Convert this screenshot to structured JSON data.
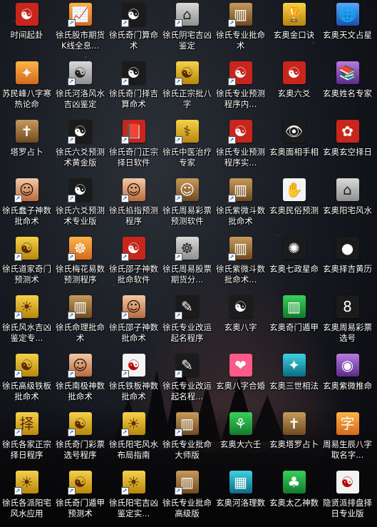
{
  "desktop": {
    "icons": [
      {
        "label": "时间起卦",
        "glyph": "☯",
        "style": "v-red",
        "shortcut": false
      },
      {
        "label": "徐氏股市期货K线全息...",
        "glyph": "📈",
        "style": "v-orange",
        "shortcut": true
      },
      {
        "label": "徐氏奇门算命术",
        "glyph": "☯",
        "style": "v-dark",
        "shortcut": true
      },
      {
        "label": "徐氏阴宅吉凶鉴定",
        "glyph": "⌂",
        "style": "v-gray",
        "shortcut": true
      },
      {
        "label": "徐氏专业批命术",
        "glyph": "▥",
        "style": "v-brown",
        "shortcut": true
      },
      {
        "label": "玄奥金口诀",
        "glyph": "🏆",
        "style": "v-gold",
        "shortcut": false
      },
      {
        "label": "玄奥天文占星",
        "glyph": "🌐",
        "style": "v-blue",
        "shortcut": false
      },
      {
        "label": "苏民峰八字寒热论命",
        "glyph": "✦",
        "style": "v-orange",
        "shortcut": false
      },
      {
        "label": "徐氏河洛风水吉凶鉴定",
        "glyph": "☯",
        "style": "v-gray",
        "shortcut": true
      },
      {
        "label": "徐氏奇门择吉算命术",
        "glyph": "☯",
        "style": "v-dark",
        "shortcut": true
      },
      {
        "label": "徐氏正宗批八字",
        "glyph": "☯",
        "style": "v-gold",
        "shortcut": true
      },
      {
        "label": "徐氏专业预测程序内...",
        "glyph": "☯",
        "style": "v-red",
        "shortcut": true
      },
      {
        "label": "玄奥六爻",
        "glyph": "☯",
        "style": "v-red",
        "shortcut": false
      },
      {
        "label": "玄奥姓名专家",
        "glyph": "📚",
        "style": "v-purple",
        "shortcut": false
      },
      {
        "label": "塔罗占卜",
        "glyph": "✝",
        "style": "v-brown",
        "shortcut": false
      },
      {
        "label": "徐氏六爻预测术黄金版",
        "glyph": "☯",
        "style": "v-dark",
        "shortcut": true
      },
      {
        "label": "徐氏奇门正宗择日软件",
        "glyph": "📕",
        "style": "v-red",
        "shortcut": true
      },
      {
        "label": "徐氏中医治疗专家",
        "glyph": "⚕",
        "style": "v-gold",
        "shortcut": true
      },
      {
        "label": "徐氏专业预测程序实...",
        "glyph": "☯",
        "style": "v-red",
        "shortcut": true
      },
      {
        "label": "玄奥面相手相",
        "glyph": "👁",
        "style": "v-dark",
        "shortcut": false
      },
      {
        "label": "玄奥玄空择日",
        "glyph": "✿",
        "style": "v-red",
        "shortcut": false
      },
      {
        "label": "徐氏蠢子神数批命术",
        "glyph": "☺",
        "style": "v-photo",
        "shortcut": true
      },
      {
        "label": "徐氏六爻预测术专业版",
        "glyph": "☯",
        "style": "v-dark",
        "shortcut": true
      },
      {
        "label": "徐氏掐指预测程序",
        "glyph": "☺",
        "style": "v-photo",
        "shortcut": true
      },
      {
        "label": "徐氏周易彩票预测软件",
        "glyph": "☺",
        "style": "v-brown",
        "shortcut": true
      },
      {
        "label": "徐氏紫微斗数批命术",
        "glyph": "▥",
        "style": "v-brown",
        "shortcut": true
      },
      {
        "label": "玄奥民俗预测",
        "glyph": "✋",
        "style": "v-white",
        "shortcut": false
      },
      {
        "label": "玄奥阳宅风水",
        "glyph": "⌂",
        "style": "v-gray",
        "shortcut": false
      },
      {
        "label": "徐氏道家奇门预测术",
        "glyph": "☯",
        "style": "v-gold",
        "shortcut": true
      },
      {
        "label": "徐氏梅花易数预测程序",
        "glyph": "☸",
        "style": "v-orange",
        "shortcut": true
      },
      {
        "label": "徐氏邵子神数批命软件",
        "glyph": "☯",
        "style": "v-red",
        "shortcut": true
      },
      {
        "label": "徐氏周易股票期货分...",
        "glyph": "☸",
        "style": "v-gray",
        "shortcut": true
      },
      {
        "label": "徐氏紫微斗数批命术...",
        "glyph": "▥",
        "style": "v-brown",
        "shortcut": true
      },
      {
        "label": "玄奥七政星命",
        "glyph": "✺",
        "style": "v-dark",
        "shortcut": false
      },
      {
        "label": "玄奥择吉黄历",
        "glyph": "●",
        "style": "v-dark",
        "shortcut": false
      },
      {
        "label": "徐氏风水吉凶鉴定专...",
        "glyph": "☀",
        "style": "v-gold",
        "shortcut": true
      },
      {
        "label": "徐氏命理批命术",
        "glyph": "▥",
        "style": "v-brown",
        "shortcut": true
      },
      {
        "label": "徐氏邵子神数批命术",
        "glyph": "☺",
        "style": "v-photo",
        "shortcut": true
      },
      {
        "label": "徐氏专业改运起名程序",
        "glyph": "✎",
        "style": "v-dark",
        "shortcut": true
      },
      {
        "label": "玄奥八字",
        "glyph": "☯",
        "style": "v-dark",
        "shortcut": false
      },
      {
        "label": "玄奥奇门遁甲",
        "glyph": "▥",
        "style": "v-green",
        "shortcut": false
      },
      {
        "label": "玄奥周易彩票选号",
        "glyph": "8",
        "style": "v-dark",
        "shortcut": false
      },
      {
        "label": "徐氏高级铁板批命术",
        "glyph": "☯",
        "style": "v-gold",
        "shortcut": true
      },
      {
        "label": "徐氏南极神数批命术",
        "glyph": "☺",
        "style": "v-photo",
        "shortcut": true
      },
      {
        "label": "徐氏铁板神数批命术",
        "glyph": "☯",
        "style": "v-white",
        "shortcut": true
      },
      {
        "label": "徐氏专业改运起名程...",
        "glyph": "✎",
        "style": "v-dark",
        "shortcut": true
      },
      {
        "label": "玄奥八字合婚",
        "glyph": "❤",
        "style": "v-pink",
        "shortcut": false
      },
      {
        "label": "玄奥三世相法",
        "glyph": "✦",
        "style": "v-teal",
        "shortcut": false
      },
      {
        "label": "玄奥紫微推命",
        "glyph": "◉",
        "style": "v-purple",
        "shortcut": false
      },
      {
        "label": "徐氏各家正宗择日程序",
        "glyph": "择",
        "style": "v-gold",
        "shortcut": true
      },
      {
        "label": "徐氏奇门彩票选号程序",
        "glyph": "☯",
        "style": "v-gold",
        "shortcut": true
      },
      {
        "label": "徐氏阳宅风水布局指南",
        "glyph": "☀",
        "style": "v-gold",
        "shortcut": true
      },
      {
        "label": "徐氏专业批命大师版",
        "glyph": "▥",
        "style": "v-brown",
        "shortcut": true
      },
      {
        "label": "玄奥大六壬",
        "glyph": "⚘",
        "style": "v-green",
        "shortcut": false
      },
      {
        "label": "玄奥塔罗占卜",
        "glyph": "✝",
        "style": "v-brown",
        "shortcut": false
      },
      {
        "label": "周易生辰八字取名字...",
        "glyph": "字",
        "style": "v-orange",
        "shortcut": false
      },
      {
        "label": "徐氏各派阳宅风水应用",
        "glyph": "☀",
        "style": "v-gold",
        "shortcut": true
      },
      {
        "label": "徐氏奇门遁甲预测术",
        "glyph": "☯",
        "style": "v-gold",
        "shortcut": true
      },
      {
        "label": "徐氏阳宅吉凶鉴定实...",
        "glyph": "☀",
        "style": "v-gold",
        "shortcut": true
      },
      {
        "label": "徐氏专业批命高级版",
        "glyph": "▥",
        "style": "v-brown",
        "shortcut": true
      },
      {
        "label": "玄奥河洛理数",
        "glyph": "▦",
        "style": "v-teal",
        "shortcut": false
      },
      {
        "label": "玄奥太乙神数",
        "glyph": "♣",
        "style": "v-green",
        "shortcut": false
      },
      {
        "label": "隐贤派排盘择日专业版",
        "glyph": "☯",
        "style": "v-white",
        "shortcut": false
      }
    ]
  }
}
